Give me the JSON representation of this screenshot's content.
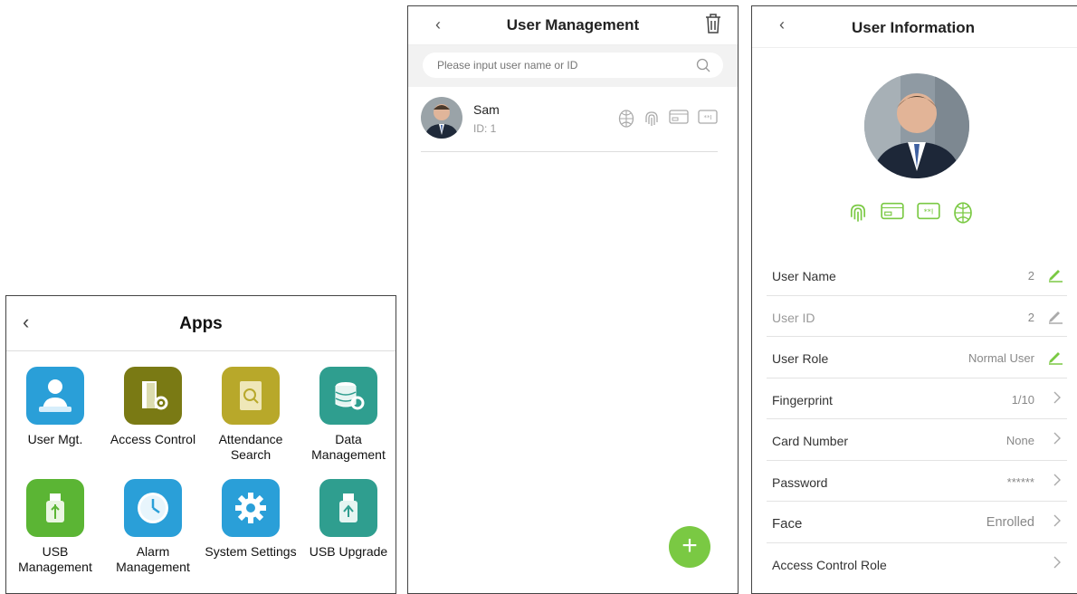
{
  "apps": {
    "title": "Apps",
    "items": [
      {
        "label_1": "User Mgt.",
        "label_2": "",
        "icon": "user-mgt-icon",
        "color": "#2a9fd8"
      },
      {
        "label_1": "Access Control",
        "label_2": "",
        "icon": "access-control-icon",
        "color": "#7a7a14"
      },
      {
        "label_1": "Attendance",
        "label_2": "Search",
        "icon": "attendance-search-icon",
        "color": "#b8a82a"
      },
      {
        "label_1": "Data",
        "label_2": "Management",
        "icon": "data-management-icon",
        "color": "#2f9e8f"
      },
      {
        "label_1": "USB",
        "label_2": "Management",
        "icon": "usb-management-icon",
        "color": "#5bb534"
      },
      {
        "label_1": "Alarm",
        "label_2": "Management",
        "icon": "alarm-management-icon",
        "color": "#2a9fd8"
      },
      {
        "label_1": "System Settings",
        "label_2": "",
        "icon": "system-settings-icon",
        "color": "#2a9fd8"
      },
      {
        "label_1": "USB Upgrade",
        "label_2": "",
        "icon": "usb-upgrade-icon",
        "color": "#2f9e8f"
      }
    ]
  },
  "user_management": {
    "title": "User Management",
    "search_placeholder": "Please input user name or ID",
    "user": {
      "name": "Sam",
      "id": "ID: 1"
    },
    "add_label": "+"
  },
  "user_information": {
    "title": "User Information",
    "accent": "#7ac943",
    "fields": [
      {
        "key": "User Name",
        "value": "2",
        "action": "edit"
      },
      {
        "key": "User ID",
        "value": "2",
        "action": "edit-disabled"
      },
      {
        "key": "User Role",
        "value": "Normal User",
        "action": "edit"
      },
      {
        "key": "Fingerprint",
        "value": "1/10",
        "action": "chevron"
      },
      {
        "key": "Card Number",
        "value": "None",
        "action": "chevron"
      },
      {
        "key": "Password",
        "value": "******",
        "action": "chevron"
      },
      {
        "key": "Face",
        "value": "Enrolled",
        "action": "chevron"
      },
      {
        "key": "Access Control Role",
        "value": "",
        "action": "chevron"
      }
    ]
  }
}
